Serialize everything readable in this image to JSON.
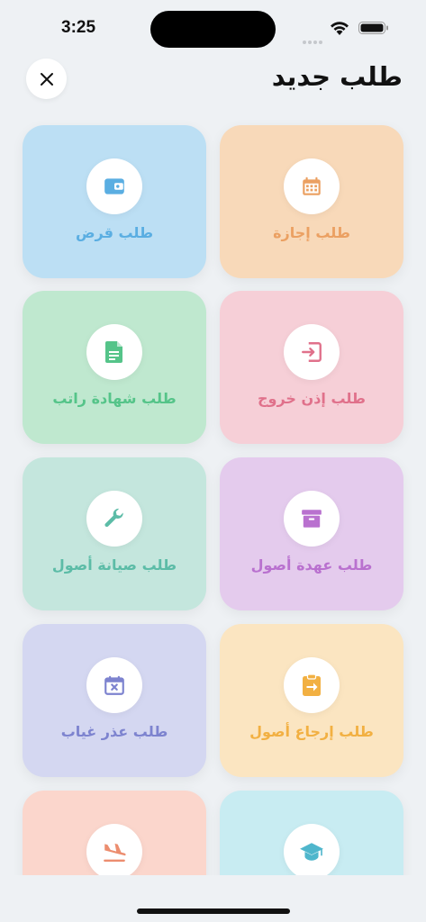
{
  "status": {
    "time": "3:25"
  },
  "header": {
    "title": "طلب جديد"
  },
  "colors": {
    "orange": {
      "bg": "#f8d9b9",
      "fg": "#eba062"
    },
    "blue": {
      "bg": "#bcdff4",
      "fg": "#5aaee2"
    },
    "pink": {
      "bg": "#f6cfd7",
      "fg": "#e0718b"
    },
    "green": {
      "bg": "#bfe8cf",
      "fg": "#55c489"
    },
    "purple": {
      "bg": "#e4cbed",
      "fg": "#b971cf"
    },
    "teal": {
      "bg": "#c4e6dd",
      "fg": "#5cbca7"
    },
    "yellow": {
      "bg": "#fbe5c1",
      "fg": "#f2b042"
    },
    "lavender": {
      "bg": "#d4d7f1",
      "fg": "#7d83cf"
    },
    "salmon": {
      "bg": "#fbd6cc",
      "fg": "#ec8d6f"
    },
    "cyan": {
      "bg": "#c8ecf2",
      "fg": "#4fb6cc"
    }
  },
  "cards": [
    {
      "label": "طلب إجازة",
      "icon": "calendar-icon"
    },
    {
      "label": "طلب قرض",
      "icon": "wallet-icon"
    },
    {
      "label": "طلب إذن خروج",
      "icon": "exit-icon"
    },
    {
      "label": "طلب شهادة راتب",
      "icon": "document-icon"
    },
    {
      "label": "طلب عهدة أصول",
      "icon": "archive-box-icon"
    },
    {
      "label": "طلب صيانة أصول",
      "icon": "wrench-icon"
    },
    {
      "label": "طلب إرجاع أصول",
      "icon": "clipboard-return-icon"
    },
    {
      "label": "طلب عذر غياب",
      "icon": "calendar-x-icon"
    },
    {
      "label": "",
      "icon": "graduation-cap-icon"
    },
    {
      "label": "",
      "icon": "plane-landing-icon"
    }
  ]
}
